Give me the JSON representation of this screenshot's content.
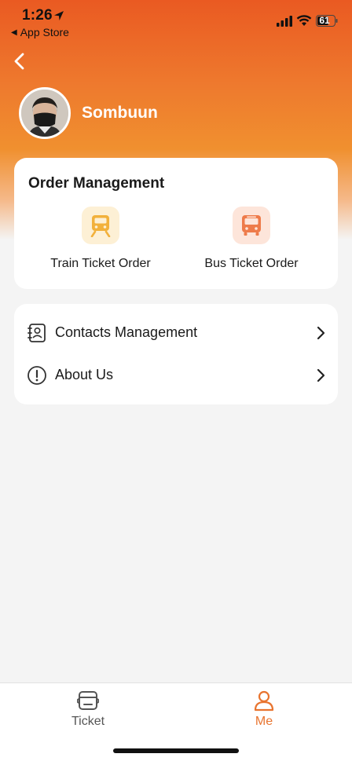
{
  "status_bar": {
    "time": "1:26",
    "back_app": "App Store",
    "battery": "61"
  },
  "profile": {
    "name": "Sombuun"
  },
  "order_management": {
    "title": "Order Management",
    "items": [
      {
        "label": "Train Ticket Order",
        "icon": "train-icon"
      },
      {
        "label": "Bus Ticket Order",
        "icon": "bus-icon"
      }
    ]
  },
  "menu": [
    {
      "label": "Contacts Management",
      "icon": "contacts-icon"
    },
    {
      "label": "About Us",
      "icon": "info-icon"
    }
  ],
  "tabbar": {
    "tabs": [
      {
        "label": "Ticket",
        "icon": "ticket-icon",
        "active": false
      },
      {
        "label": "Me",
        "icon": "person-icon",
        "active": true
      }
    ]
  },
  "colors": {
    "accent": "#e8742f",
    "hero_top": "#ea5a22",
    "train_icon": "#f2b13c",
    "bus_icon": "#ee7b4a"
  }
}
